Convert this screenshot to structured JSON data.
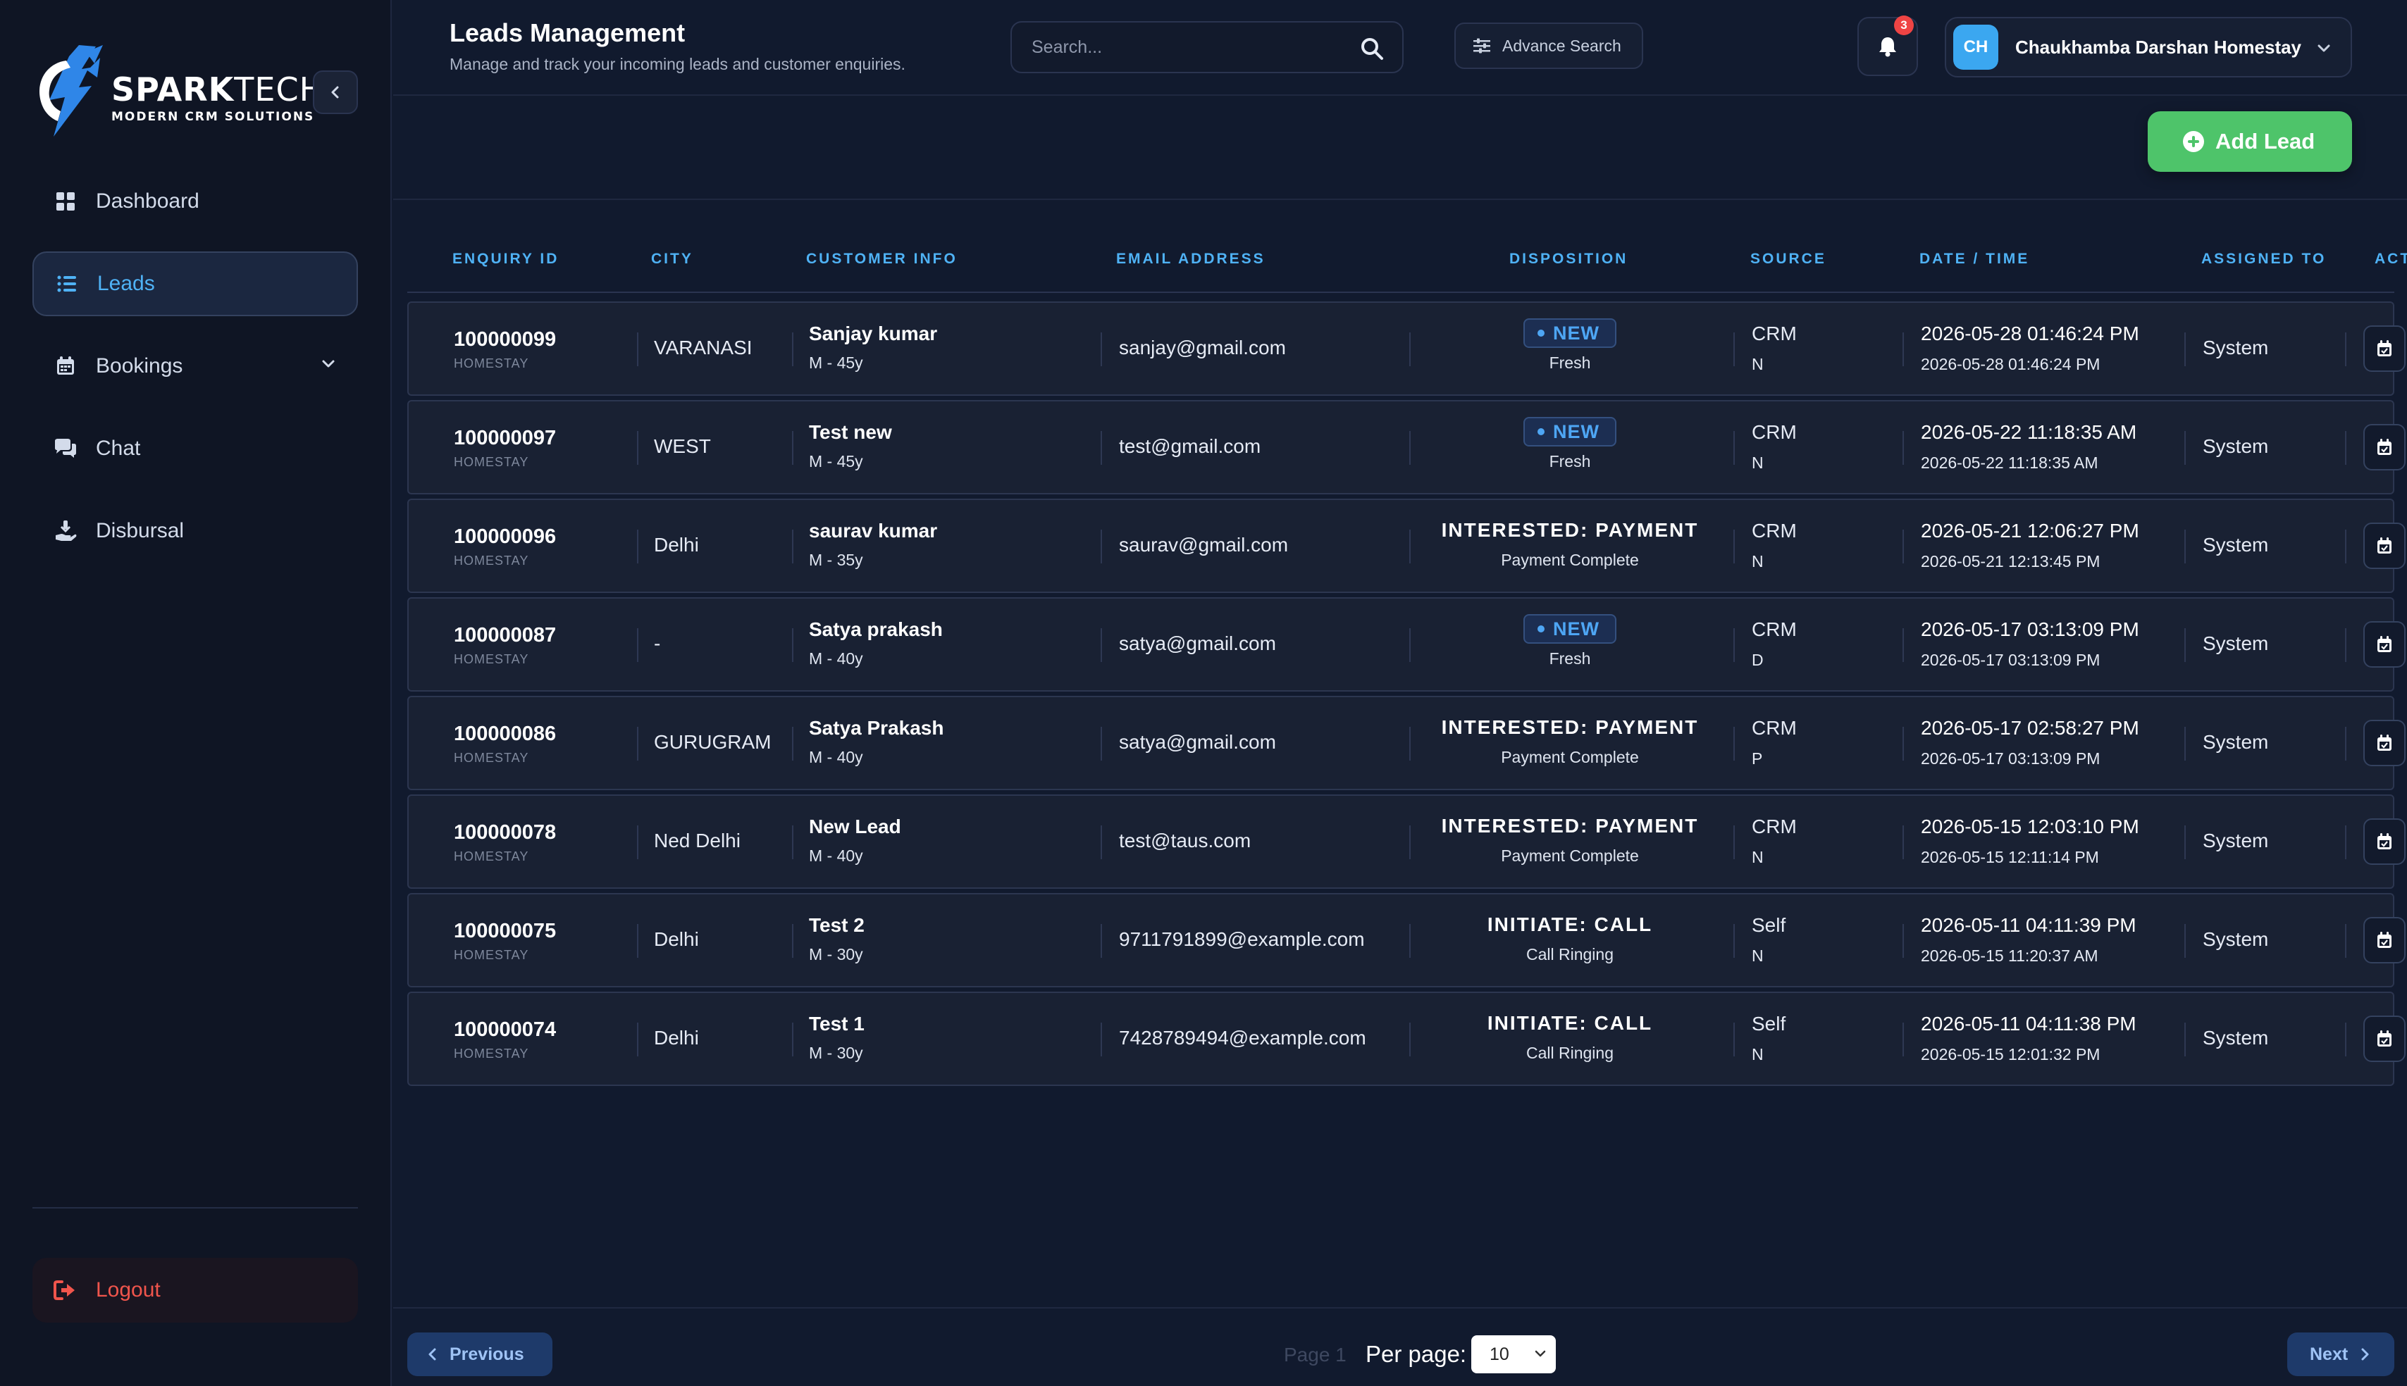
{
  "brand": {
    "name_bold": "SPARK",
    "name_light": "TECH",
    "tagline": "MODERN CRM SOLUTIONS"
  },
  "sidebar": {
    "items": [
      {
        "label": "Dashboard",
        "icon": "grid-icon"
      },
      {
        "label": "Leads",
        "icon": "list-icon",
        "active": true
      },
      {
        "label": "Bookings",
        "icon": "calendar-icon"
      },
      {
        "label": "Chat",
        "icon": "chat-icon"
      },
      {
        "label": "Disbursal",
        "icon": "hand-coin-icon"
      }
    ],
    "logout_label": "Logout"
  },
  "header": {
    "title": "Leads Management",
    "subtitle": "Manage and track your incoming leads and customer enquiries.",
    "search_placeholder": "Search...",
    "advance_search_label": "Advance Search",
    "notification_count": "3",
    "user_initials": "CH",
    "user_name": "Chaukhamba Darshan Homestay"
  },
  "toolbar": {
    "add_lead_label": "Add Lead"
  },
  "table": {
    "columns": [
      "ENQUIRY ID",
      "CITY",
      "CUSTOMER INFO",
      "EMAIL ADDRESS",
      "DISPOSITION",
      "SOURCE",
      "DATE / TIME",
      "ASSIGNED TO",
      "ACT"
    ],
    "rows": [
      {
        "id": "100000099",
        "type": "HOMESTAY",
        "city": "VARANASI",
        "name": "Sanjay kumar",
        "meta": "M - 45y",
        "email": "sanjay@gmail.com",
        "badge": "NEW",
        "disposition": "",
        "disposition_sub": "Fresh",
        "source": "CRM",
        "source_sub": "N",
        "created": "2026-05-28 01:46:24 PM",
        "updated": "2026-05-28 01:46:24 PM",
        "assigned": "System"
      },
      {
        "id": "100000097",
        "type": "HOMESTAY",
        "city": "WEST",
        "name": "Test new",
        "meta": "M - 45y",
        "email": "test@gmail.com",
        "badge": "NEW",
        "disposition": "",
        "disposition_sub": "Fresh",
        "source": "CRM",
        "source_sub": "N",
        "created": "2026-05-22 11:18:35 AM",
        "updated": "2026-05-22 11:18:35 AM",
        "assigned": "System"
      },
      {
        "id": "100000096",
        "type": "HOMESTAY",
        "city": "Delhi",
        "name": "saurav kumar",
        "meta": "M - 35y",
        "email": "saurav@gmail.com",
        "badge": "",
        "disposition": "INTERESTED: PAYMENT",
        "disposition_sub": "Payment Complete",
        "source": "CRM",
        "source_sub": "N",
        "created": "2026-05-21 12:06:27 PM",
        "updated": "2026-05-21 12:13:45 PM",
        "assigned": "System"
      },
      {
        "id": "100000087",
        "type": "HOMESTAY",
        "city": "-",
        "name": "Satya prakash",
        "meta": "M - 40y",
        "email": "satya@gmail.com",
        "badge": "NEW",
        "disposition": "",
        "disposition_sub": "Fresh",
        "source": "CRM",
        "source_sub": "D",
        "created": "2026-05-17 03:13:09 PM",
        "updated": "2026-05-17 03:13:09 PM",
        "assigned": "System"
      },
      {
        "id": "100000086",
        "type": "HOMESTAY",
        "city": "GURUGRAM",
        "name": "Satya Prakash",
        "meta": "M - 40y",
        "email": "satya@gmail.com",
        "badge": "",
        "disposition": "INTERESTED: PAYMENT",
        "disposition_sub": "Payment Complete",
        "source": "CRM",
        "source_sub": "P",
        "created": "2026-05-17 02:58:27 PM",
        "updated": "2026-05-17 03:13:09 PM",
        "assigned": "System"
      },
      {
        "id": "100000078",
        "type": "HOMESTAY",
        "city": "Ned Delhi",
        "name": "New Lead",
        "meta": "M - 40y",
        "email": "test@taus.com",
        "badge": "",
        "disposition": "INTERESTED: PAYMENT",
        "disposition_sub": "Payment Complete",
        "source": "CRM",
        "source_sub": "N",
        "created": "2026-05-15 12:03:10 PM",
        "updated": "2026-05-15 12:11:14 PM",
        "assigned": "System"
      },
      {
        "id": "100000075",
        "type": "HOMESTAY",
        "city": "Delhi",
        "name": "Test 2",
        "meta": "M - 30y",
        "email": "9711791899@example.com",
        "badge": "",
        "disposition": "INITIATE: CALL",
        "disposition_sub": "Call Ringing",
        "source": "Self",
        "source_sub": "N",
        "created": "2026-05-11 04:11:39 PM",
        "updated": "2026-05-15 11:20:37 AM",
        "assigned": "System"
      },
      {
        "id": "100000074",
        "type": "HOMESTAY",
        "city": "Delhi",
        "name": "Test 1",
        "meta": "M - 30y",
        "email": "7428789494@example.com",
        "badge": "",
        "disposition": "INITIATE: CALL",
        "disposition_sub": "Call Ringing",
        "source": "Self",
        "source_sub": "N",
        "created": "2026-05-11 04:11:38 PM",
        "updated": "2026-05-15 12:01:32 PM",
        "assigned": "System"
      }
    ]
  },
  "pagination": {
    "previous_label": "Previous",
    "next_label": "Next",
    "page_label": "Page 1",
    "per_page_label": "Per page:",
    "per_page_value": "10",
    "per_page_options": [
      "10"
    ]
  },
  "colors": {
    "accent": "#4fb2f5",
    "success": "#4ec46a",
    "danger": "#f0554c",
    "background": "#111a2e",
    "sidebar": "#0f1524"
  }
}
